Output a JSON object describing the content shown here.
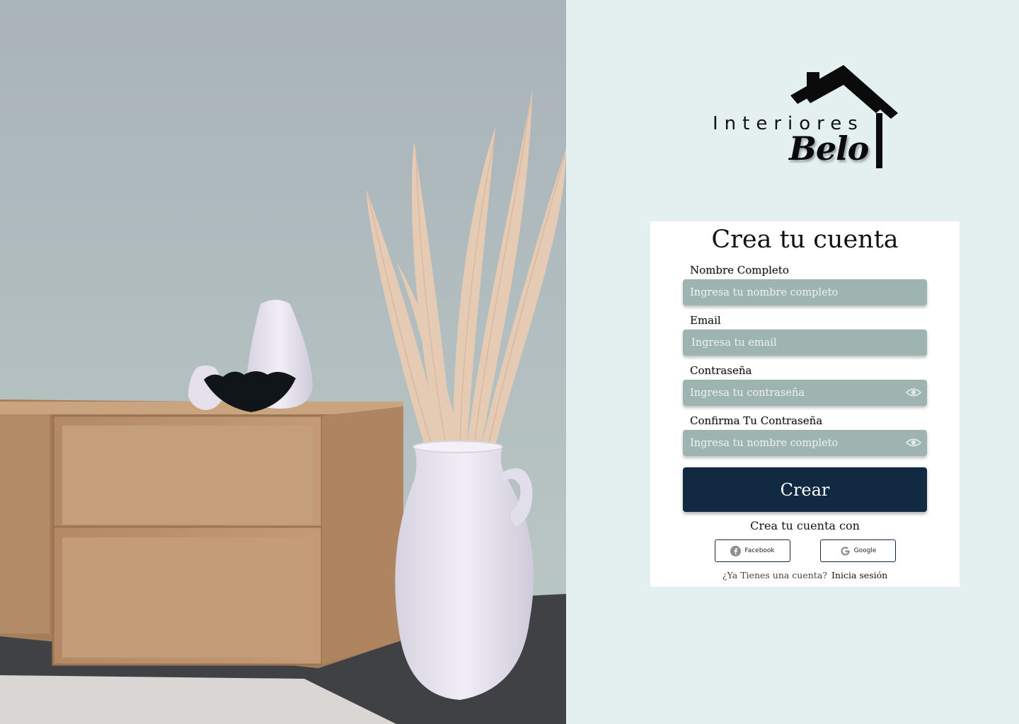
{
  "logo": {
    "word": "Interiores",
    "brand": "Belo"
  },
  "form": {
    "title": "Crea tu cuenta",
    "fields": [
      {
        "label": "Nombre Completo",
        "placeholder": "Ingresa tu nombre completo",
        "value": "",
        "icon": null
      },
      {
        "label": "Email",
        "placeholder": "Ingresa tu email",
        "value": "",
        "icon": null
      },
      {
        "label": "Contraseña",
        "placeholder": "Ingresa tu contraseña",
        "value": "",
        "icon": "eye-icon"
      },
      {
        "label": "Confirma Tu Contraseña",
        "placeholder": "Ingresa tu nombre completo",
        "value": "",
        "icon": "eye-icon"
      }
    ],
    "submit_label": "Crear",
    "social_prompt": "Crea tu cuenta con",
    "social": [
      {
        "label": "Facebook",
        "icon": "facebook-icon"
      },
      {
        "label": "Google",
        "icon": "google-icon"
      }
    ],
    "signin_prompt": "¿Ya Tienes una cuenta?",
    "signin_link": "Inicia sesión"
  },
  "colors": {
    "page_bg": "#e3f0ef",
    "field_bg": "#9eb4b1",
    "primary": "#112a42",
    "card_bg": "#ffffff"
  }
}
